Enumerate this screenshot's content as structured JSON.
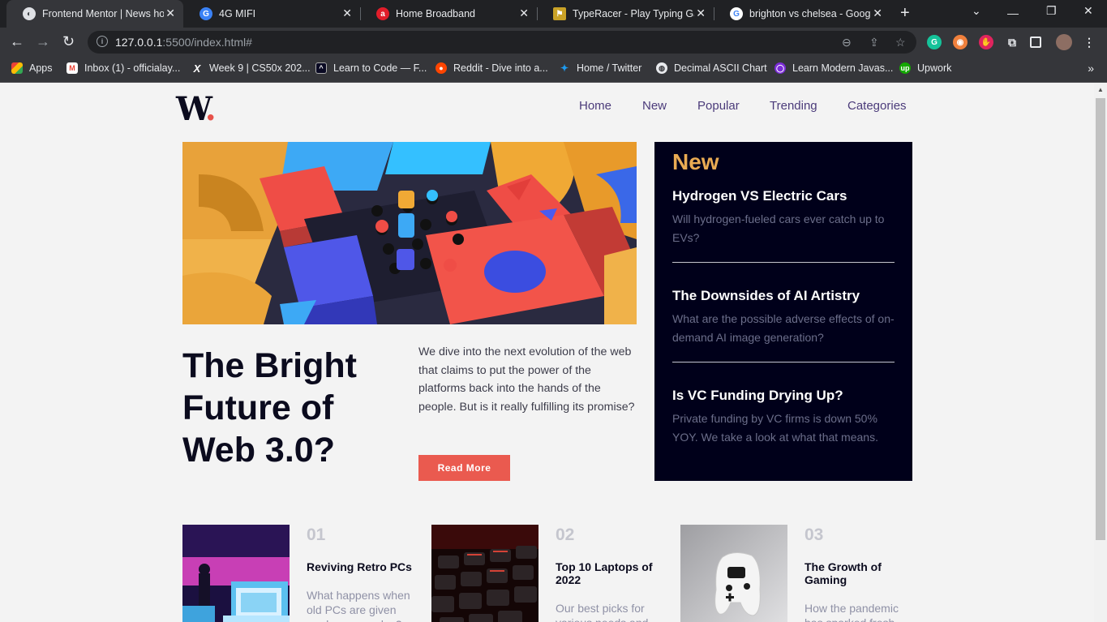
{
  "browser": {
    "tabs": [
      {
        "title": "Frontend Mentor | News hom",
        "active": true,
        "icon": "frontend-mentor-icon"
      },
      {
        "title": "4G MIFI",
        "active": false,
        "icon": "globe-icon"
      },
      {
        "title": "Home Broadband",
        "active": false,
        "icon": "airtel-icon"
      },
      {
        "title": "TypeRacer - Play Typing Gam",
        "active": false,
        "icon": "typeracer-icon"
      },
      {
        "title": "brighton vs chelsea - Google",
        "active": false,
        "icon": "google-icon"
      }
    ],
    "url_host": "127.0.0.1",
    "url_path": ":5500/index.html#",
    "bookmarks": [
      {
        "label": "Apps",
        "icon": "apps-grid-icon"
      },
      {
        "label": "Inbox (1) - officialay...",
        "icon": "gmail-icon"
      },
      {
        "label": "Week 9 | CS50x 202...",
        "icon": "cs50-icon"
      },
      {
        "label": "Learn to Code — F...",
        "icon": "freecodecamp-icon"
      },
      {
        "label": "Reddit - Dive into a...",
        "icon": "reddit-icon"
      },
      {
        "label": "Home / Twitter",
        "icon": "twitter-icon"
      },
      {
        "label": "Decimal ASCII Chart",
        "icon": "globe-icon"
      },
      {
        "label": "Learn Modern Javas...",
        "icon": "scrimba-icon"
      },
      {
        "label": "Upwork",
        "icon": "upwork-icon"
      }
    ]
  },
  "site": {
    "logo_letter": "W",
    "logo_dot": ".",
    "nav": [
      "Home",
      "New",
      "Popular",
      "Trending",
      "Categories"
    ],
    "hero": {
      "title": "The Bright Future of Web 3.0?",
      "description": "We dive into the next evolution of the web that claims to put the power of the platforms back into the hands of the people. But is it really fulfilling its promise?",
      "button": "Read More"
    },
    "new_panel": {
      "heading": "New",
      "items": [
        {
          "title": "Hydrogen VS Electric Cars",
          "description": "Will hydrogen-fueled cars ever catch up to EVs?"
        },
        {
          "title": "The Downsides of AI Artistry",
          "description": "What are the possible adverse effects of on-demand AI image generation?"
        },
        {
          "title": "Is VC Funding Drying Up?",
          "description": "Private funding by VC firms is down 50% YOY. We take a look at what that means."
        }
      ]
    },
    "cards": [
      {
        "number": "01",
        "title": "Reviving Retro PCs",
        "description": "What happens when old PCs are given modern upgrades?"
      },
      {
        "number": "02",
        "title": "Top 10 Laptops of 2022",
        "description": "Our best picks for various needs and budgets."
      },
      {
        "number": "03",
        "title": "The Growth of Gaming",
        "description": "How the pandemic has sparked fresh opportunities."
      }
    ]
  },
  "colors": {
    "accent_red": "#ea5a4f",
    "accent_orange": "#e9ab53",
    "dark_navy": "#00001a",
    "nav_purple": "#4b3b7a"
  }
}
